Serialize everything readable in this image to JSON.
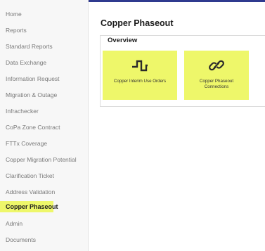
{
  "sidebar": {
    "items": [
      {
        "label": "Home",
        "active": false
      },
      {
        "label": "Reports",
        "active": false
      },
      {
        "label": "Standard Reports",
        "active": false
      },
      {
        "label": "Data Exchange",
        "active": false
      },
      {
        "label": "Information Request",
        "active": false
      },
      {
        "label": "Migration & Outage",
        "active": false
      },
      {
        "label": "Infrachecker",
        "active": false
      },
      {
        "label": "CoPa Zone Contract",
        "active": false
      },
      {
        "label": "FTTx Coverage",
        "active": false
      },
      {
        "label": "Copper Migration Potential",
        "active": false
      },
      {
        "label": "Clarification Ticket",
        "active": false
      },
      {
        "label": "Address Validation",
        "active": false
      },
      {
        "label": "Copper Phaseout",
        "active": true
      },
      {
        "label": "Admin",
        "active": false
      },
      {
        "label": "Documents",
        "active": false
      }
    ]
  },
  "main": {
    "title": "Copper Phaseout",
    "overview": {
      "legend": "Overview",
      "tiles": [
        {
          "label": "Copper Interim Use Orders",
          "icon": "square-wave-icon"
        },
        {
          "label": "Copper Phaseout Connections",
          "icon": "link-icon"
        }
      ]
    }
  },
  "colors": {
    "accent": "#eef76a",
    "topbar": "#2f3a8f",
    "sidebar_bg": "#f7f7f7"
  }
}
